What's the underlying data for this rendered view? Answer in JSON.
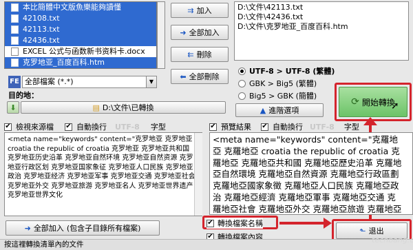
{
  "file_list": {
    "rows": [
      {
        "name": "本比簡體中文版魚樂能夠讀懂",
        "style": "blue"
      },
      {
        "name": "42108.txt",
        "style": "blue"
      },
      {
        "name": "42113.txt",
        "style": "blue"
      },
      {
        "name": "42436.txt",
        "style": "blue"
      },
      {
        "name": "EXCEL 公式与函数新书资料卡.docx",
        "style": "white"
      },
      {
        "name": "克罗地亚_百度百科.htm",
        "style": "blue"
      }
    ]
  },
  "buttons": {
    "add": "加入",
    "add_all": "全部加入",
    "remove": "刪除",
    "remove_all": "全部刪除",
    "start": "開始轉換",
    "advanced": "進階選項",
    "exit": "退出",
    "add_all_with_sub": "全部加入",
    "add_all_with_sub_hint": "(包含子目錄所有檔案)"
  },
  "output_list": {
    "lines": [
      "D:\\文件\\42113.txt",
      "D:\\文件\\42436.txt",
      "D:\\文件\\克罗地亚_百度百科.htm"
    ]
  },
  "filter": {
    "tag": "FE",
    "value": "全部檔案 (*.*)"
  },
  "target": {
    "label": "目的地：",
    "path": "D:\\文件\\已轉換"
  },
  "encoding_options": [
    {
      "label": "UTF-8 > UTF-8 (繁體)",
      "selected": true
    },
    {
      "label": "GBK > Big5 (繁體)",
      "selected": false
    },
    {
      "label": "Big5 > GBK (簡體)",
      "selected": false
    }
  ],
  "left_pane": {
    "check_source": "檢視來源檔",
    "auto_wrap": "自動換行",
    "encoding": "UTF-8",
    "font": "字型",
    "text": "<meta name=\"keywords\" content=\"克罗地亚 克罗地亚 croatia the republic of croatia 克罗地亚 克罗地亚共和国 克罗地亚历史沿革 克罗地亚自然环境 克罗地亚自然资源 克罗地亚行政区划 克罗地亚国家象征 克罗地亚人口民族 克罗地亚政治 克罗地亚经济 克罗地亚军事 克罗地亚交通 克罗地亚社会 克罗地亚外交 克罗地亚旅游 克罗地亚名人 克罗地亚世界遗产 克罗地亚世界文化"
  },
  "right_pane": {
    "preview": "預覽結果",
    "auto_wrap": "自動換行",
    "encoding": "UTF-8",
    "font": "字型",
    "text": "<meta name=\"keywords\" content=\"克羅地亞 克羅地亞 croatia the republic of croatia 克羅地亞 克羅地亞共和國 克羅地亞歷史沿革 克羅地亞自然環境 克羅地亞自然資源 克羅地亞行政區劃 克羅地亞國家象徵 克羅地亞人口民族 克羅地亞政治 克羅地亞經濟 克羅地亞軍事 克羅地亞交通 克羅地亞社會 克羅地亞外交 克羅地亞旅遊 克羅地亞名人 克羅地亞"
  },
  "options": {
    "convert_filename": "轉換檔案名稱",
    "convert_content": "轉換檔案內容"
  },
  "status": "按這裡轉換清單內的文件",
  "watermark": "techbang.com",
  "colors": {
    "selection": "#2f6ad0",
    "highlight_red": "#d4242c",
    "start_button": "#8fd58a"
  }
}
